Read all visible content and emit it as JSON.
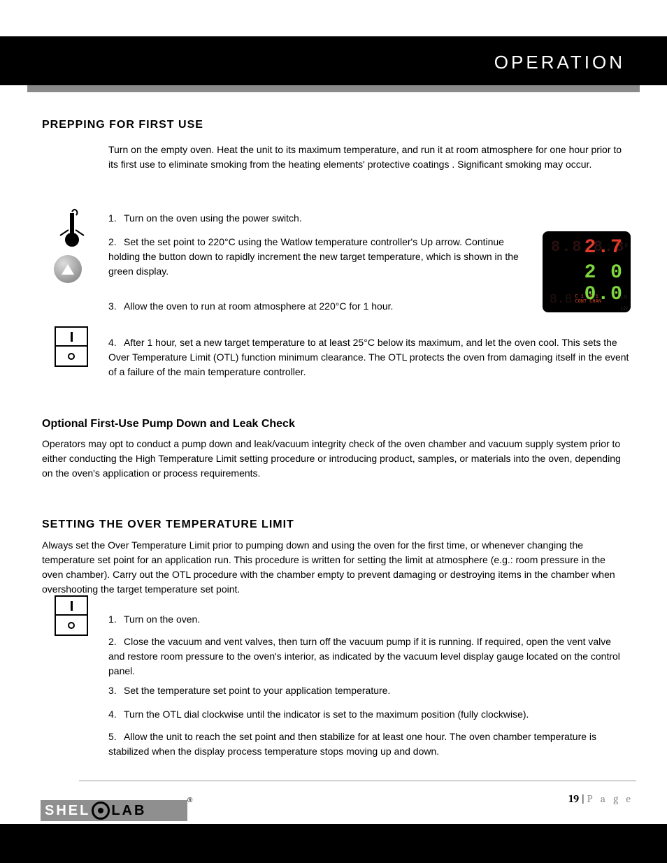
{
  "header": {
    "title": "OPERATION"
  },
  "sections": {
    "prepping": {
      "title": "PREPPING FOR FIRST USE",
      "p1": "Turn on the empty oven. Heat the unit to its maximum temperature, and run it at room atmosphere for one hour prior to its first use",
      "p1b": "to eliminate smoking from the heating elements' protective coatings",
      "p1c": ". Significant smoking may occur.",
      "step1": "Turn on the oven using the power switch.",
      "step2a": "Set the set point to 220",
      "degC": "°",
      "step2b": "C",
      "step2c": "using the Watlow temperature controller's",
      "step2d": "Up arrow. Continue holding the button down to rapidly increment the new target temperature, which is shown in the green display.",
      "step3a": "Allow the oven to run at room atmosphere at 220",
      "step3b": "C for 1 hour.",
      "step4a": "After 1 hour, set a new target temperature to at least 25",
      "step4b": "C below its maximum, and let the oven cool. This sets the Over Temperature Limit (OTL) function minimum clearance. The OTL protects the oven from damaging itself in the event of a failure of the main temperature controller."
    },
    "optional": {
      "title": "Optional First-Use Pump Down and Leak Check",
      "p": "Operators may opt to conduct a pump down and leak/vacuum integrity check of the oven chamber and vacuum supply system prior to either conducting the High Temperature Limit setting procedure or introducing product, samples, or materials into the oven, depending on ",
      "pb": "the oven's application or process",
      "pc": " requirements."
    },
    "otl": {
      "title": "SETTING THE OVER TEMPERATURE LIMIT",
      "intro": "Always set the Over Temperature Limit prior to pumping down and using the oven for the first time, or whenever changing the temperature set point for an application run. This procedure is written for setting the limit at atmosphere (e.g.: room pressure in the oven chamber). Carry out the OTL procedure with the chamber empty to prevent damaging or destroying items in the chamber when overshooting the target temperature set point.",
      "step1": "Turn on the oven.",
      "step2a": "Close the vacuum and vent valves, then turn off the vacuum pump if it is running. If required, open the vent valve",
      "step2b": "and restore room pressure to the oven's",
      "step2c": "interior, as indicated by the vacuum level display gauge located on the control panel.",
      "step3": "Set the temperature set point to your application temperature.",
      "step4": "Turn the OTL dial clockwise until the indicator is set to the maximum position (fully clockwise).",
      "step5": "Allow the unit to reach the set point and then stabilize for at least one hour. The oven chamber temperature is stabilized when the display process temperature stops moving up and down."
    }
  },
  "watlow": {
    "red_dim": "8.8.8.8",
    "red": "2.7",
    "green": "2 0 0.0",
    "red_dim_small": "8.8",
    "mini1_top": "C 1",
    "mini1_bot": "CONT",
    "mini2_top": "C 1",
    "mini2_bot": "CHAN",
    "unit_c": "C",
    "label_l1": "L21",
    "label_l2": "L22"
  },
  "footer": {
    "page_num": "19",
    "sep": " | ",
    "page_word": "P a g e",
    "logo_shel": "SHEL",
    "logo_lab": "LAB",
    "reg": "®"
  }
}
